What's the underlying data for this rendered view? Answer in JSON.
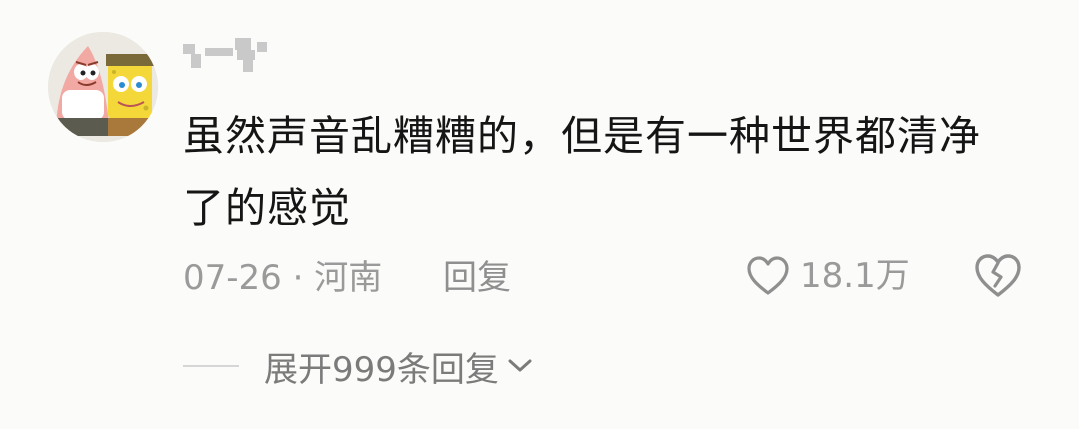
{
  "comment": {
    "text": "虽然声音乱糟糟的，但是有一种世界都清净了的感觉",
    "date": "07-26",
    "separator": "·",
    "location": "河南",
    "reply_label": "回复",
    "like_count": "18.1万",
    "expand_replies_label": "展开999条回复"
  },
  "icons": {
    "like": "heart-outline-icon",
    "dislike": "broken-heart-icon",
    "expand": "chevron-down-icon"
  },
  "colors": {
    "background": "#fbfbf9",
    "text_primary": "#151515",
    "text_secondary": "#9a9a9a"
  }
}
